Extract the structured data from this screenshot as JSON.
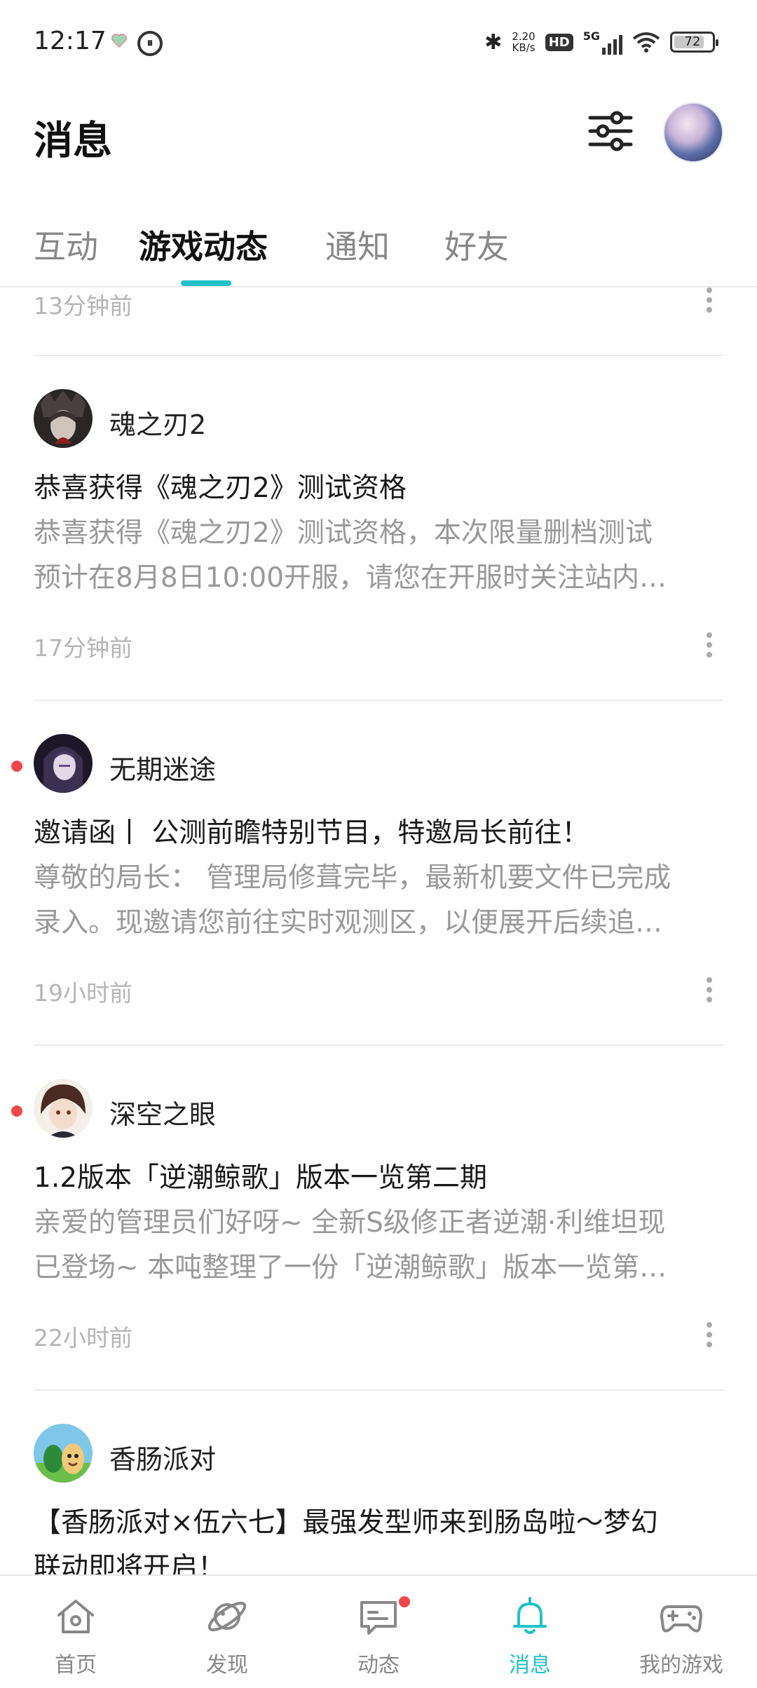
{
  "status_bar": {
    "time": "12:17",
    "net_speed_value": "2.20",
    "net_speed_unit": "KB/s",
    "hd_label": "HD",
    "network_label": "5G",
    "battery_level": "72"
  },
  "header": {
    "title": "消息"
  },
  "tabs": [
    {
      "label": "互动",
      "active": false
    },
    {
      "label": "游戏动态",
      "active": true
    },
    {
      "label": "通知",
      "active": false
    },
    {
      "label": "好友",
      "active": false
    }
  ],
  "feed": {
    "partial_item_time": "13分钟前",
    "items": [
      {
        "game": "魂之刃2",
        "unread": false,
        "title": "恭喜获得《魂之刃2》测试资格",
        "body_line1": "恭喜获得《魂之刃2》测试资格，本次限量删档测试",
        "body_line2": "预计在8月8日10:00开服，请您在开服时关注站内…",
        "time": "17分钟前"
      },
      {
        "game": "无期迷途",
        "unread": true,
        "title": "邀请函丨  公测前瞻特别节目，特邀局长前往！",
        "body_line1": "尊敬的局长：  管理局修葺完毕，最新机要文件已完成",
        "body_line2": "录入。现邀请您前往实时观测区，以便展开后续追…",
        "time": "19小时前"
      },
      {
        "game": "深空之眼",
        "unread": true,
        "title": "1.2版本「逆潮鲸歌」版本一览第二期",
        "body_line1": "亲爱的管理员们好呀~ 全新S级修正者逆潮·利维坦现",
        "body_line2": "已登场~ 本吨整理了一份「逆潮鲸歌」版本一览第…",
        "time": "22小时前"
      },
      {
        "game": "香肠派对",
        "unread": false,
        "title_line1": "【香肠派对×伍六七】最强发型师来到肠岛啦～梦幻",
        "title_line2": "联动即将开启！"
      }
    ]
  },
  "bottom_nav": [
    {
      "label": "首页",
      "icon": "home-icon",
      "active": false
    },
    {
      "label": "发现",
      "icon": "planet-icon",
      "active": false
    },
    {
      "label": "动态",
      "icon": "chat-icon",
      "active": false,
      "badge": true
    },
    {
      "label": "消息",
      "icon": "bell-icon",
      "active": true
    },
    {
      "label": "我的游戏",
      "icon": "gamepad-icon",
      "active": false
    }
  ],
  "colors": {
    "accent": "#1fc2c8",
    "unread_dot": "#f04848",
    "secondary_text": "#999999"
  }
}
